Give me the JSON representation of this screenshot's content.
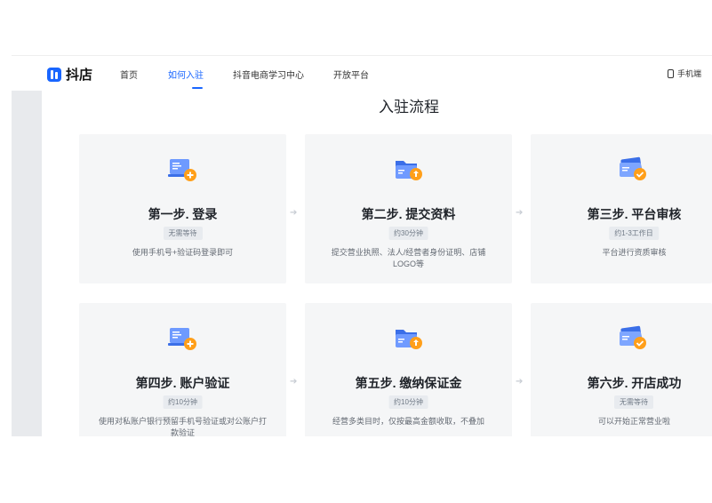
{
  "nav": {
    "logo_text": "抖店",
    "items": [
      "首页",
      "如何入驻",
      "抖音电商学习中心",
      "开放平台"
    ],
    "active": "如何入驻",
    "mobile_label": "手机端"
  },
  "page_title": "入驻流程",
  "steps": [
    {
      "title": "第一步. 登录",
      "badge": "无需等待",
      "desc": "使用手机号+验证码登录即可",
      "icon": "laptop-plus-icon"
    },
    {
      "title": "第二步. 提交资料",
      "badge": "约30分钟",
      "desc": "提交营业执照、法人/经营者身份证明、店铺LOGO等",
      "icon": "folder-upload-icon"
    },
    {
      "title": "第三步. 平台审核",
      "badge": "约1-3工作日",
      "desc": "平台进行资质审核",
      "icon": "card-check-icon"
    },
    {
      "title": "第四步. 账户验证",
      "badge": "约10分钟",
      "desc": "使用对私账户银行预留手机号验证或对公账户打款验证",
      "icon": "laptop-plus-icon"
    },
    {
      "title": "第五步. 缴纳保证金",
      "badge": "约10分钟",
      "desc": "经营多类目时，仅按最高金额收取，不叠加",
      "icon": "folder-upload-icon"
    },
    {
      "title": "第六步. 开店成功",
      "badge": "无需等待",
      "desc": "可以开始正常营业啦",
      "icon": "card-check-icon"
    }
  ],
  "colors": {
    "accent": "#1966ff",
    "icon_orange": "#ff9f1a",
    "card_bg": "#f5f6f7"
  }
}
